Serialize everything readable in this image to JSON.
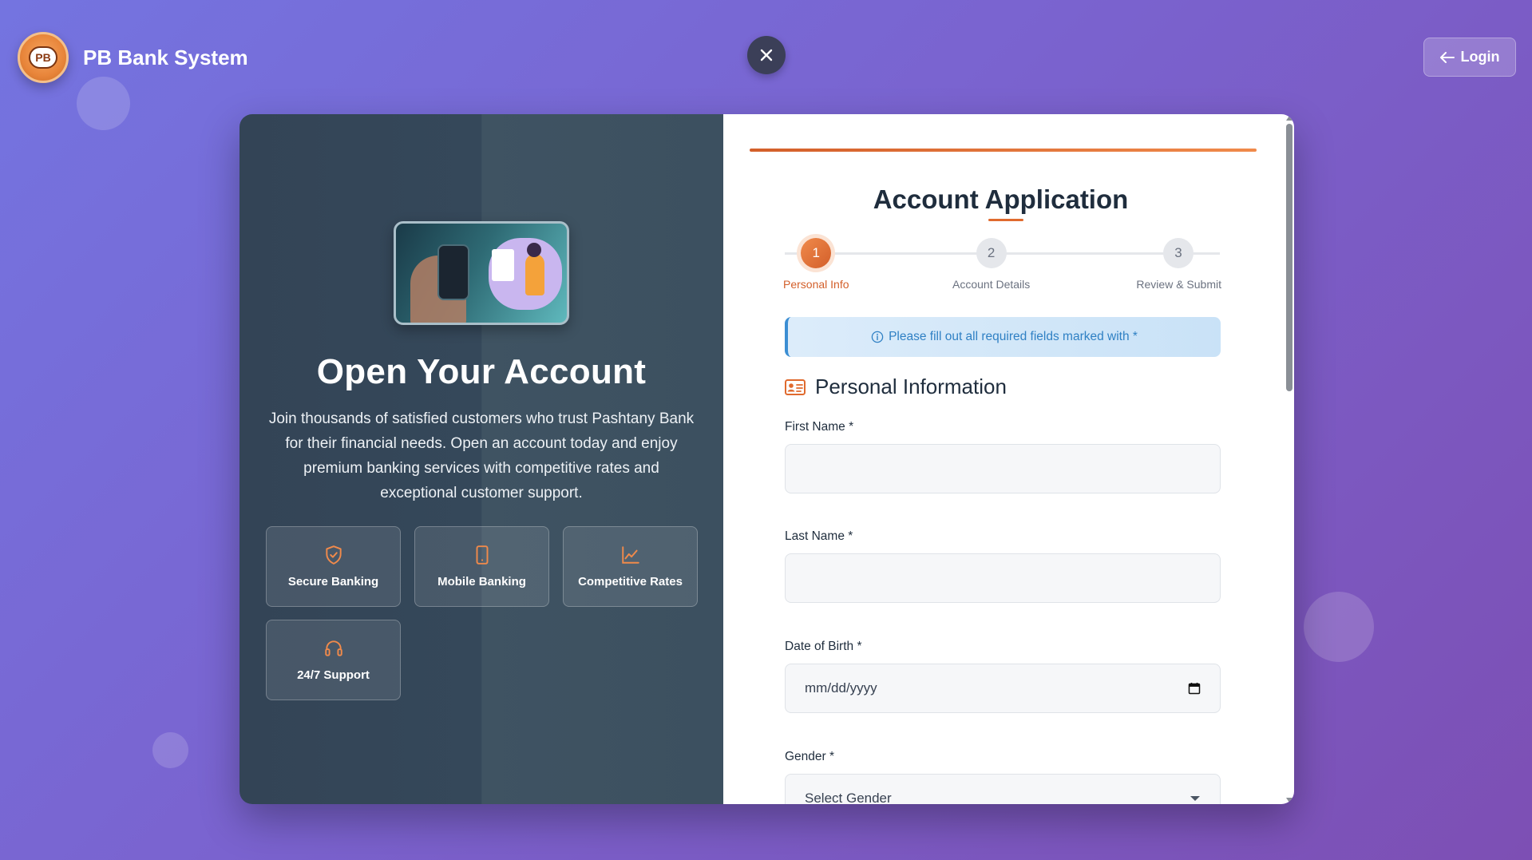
{
  "header": {
    "brand_name": "PB Bank System",
    "logo_text": "PB",
    "login_label": "Login"
  },
  "hero": {
    "title": "Open Your Account",
    "intro": "Join thousands of satisfied customers who trust Pashtany Bank for their financial needs. Open an account today and enjoy premium banking services with competitive rates and exceptional customer support.",
    "features": [
      {
        "label": "Secure Banking",
        "icon": "shield-check-icon"
      },
      {
        "label": "Mobile Banking",
        "icon": "mobile-icon"
      },
      {
        "label": "Competitive Rates",
        "icon": "chart-line-icon"
      },
      {
        "label": "24/7 Support",
        "icon": "headset-icon"
      }
    ]
  },
  "form": {
    "title": "Account Application",
    "steps": [
      {
        "number": "1",
        "label": "Personal Info",
        "active": true
      },
      {
        "number": "2",
        "label": "Account Details",
        "active": false
      },
      {
        "number": "3",
        "label": "Review & Submit",
        "active": false
      }
    ],
    "notice": "Please fill out all required fields marked with *",
    "section_title": "Personal Information",
    "fields": {
      "first_name": {
        "label": "First Name *",
        "value": ""
      },
      "last_name": {
        "label": "Last Name *",
        "value": ""
      },
      "dob": {
        "label": "Date of Birth *",
        "placeholder": "mm/dd/yyyy"
      },
      "gender": {
        "label": "Gender *",
        "selected": "Select Gender"
      }
    }
  },
  "colors": {
    "accent": "#e06a2e",
    "info": "#2f80c4",
    "panel_dark": "#34475a"
  }
}
